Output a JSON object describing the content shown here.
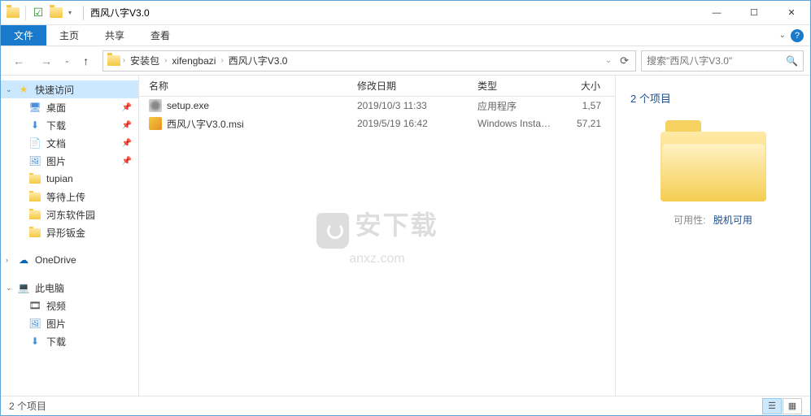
{
  "window": {
    "title": "西风八字V3.0",
    "min": "—",
    "max": "☐",
    "close": "✕"
  },
  "ribbon": {
    "tabs": [
      "文件",
      "主页",
      "共享",
      "查看"
    ]
  },
  "nav": {
    "back": "←",
    "forward": "→",
    "up": "↑",
    "history": "⌄",
    "refresh": "⟳",
    "dropdown": "⌄"
  },
  "breadcrumbs": [
    "安装包",
    "xifengbazi",
    "西风八字V3.0"
  ],
  "search": {
    "placeholder": "搜索\"西风八字V3.0\""
  },
  "sidebar": {
    "quick": "快速访问",
    "items": [
      {
        "label": "桌面",
        "icon": "desktop",
        "pin": true
      },
      {
        "label": "下载",
        "icon": "download",
        "pin": true
      },
      {
        "label": "文档",
        "icon": "doc",
        "pin": true
      },
      {
        "label": "图片",
        "icon": "pic",
        "pin": true
      },
      {
        "label": "tupian",
        "icon": "folder",
        "pin": false
      },
      {
        "label": "等待上传",
        "icon": "folder",
        "pin": false
      },
      {
        "label": "河东软件园",
        "icon": "folder",
        "pin": false
      },
      {
        "label": "异形钣金",
        "icon": "folder",
        "pin": false
      }
    ],
    "onedrive": "OneDrive",
    "thispc": "此电脑",
    "pc_items": [
      {
        "label": "视频",
        "icon": "video"
      },
      {
        "label": "图片",
        "icon": "pic"
      },
      {
        "label": "下载",
        "icon": "download"
      }
    ]
  },
  "columns": {
    "name": "名称",
    "date": "修改日期",
    "type": "类型",
    "size": "大小"
  },
  "files": [
    {
      "name": "setup.exe",
      "date": "2019/10/3 11:33",
      "type": "应用程序",
      "size": "1,57",
      "icon": "exe"
    },
    {
      "name": "西风八字V3.0.msi",
      "date": "2019/5/19 16:42",
      "type": "Windows Install...",
      "size": "57,21",
      "icon": "msi"
    }
  ],
  "details": {
    "title": "2 个项目",
    "avail_label": "可用性:",
    "avail_value": "脱机可用"
  },
  "status": {
    "text": "2 个项目"
  },
  "watermark": {
    "title": "安下载",
    "sub": "anxz.com"
  }
}
